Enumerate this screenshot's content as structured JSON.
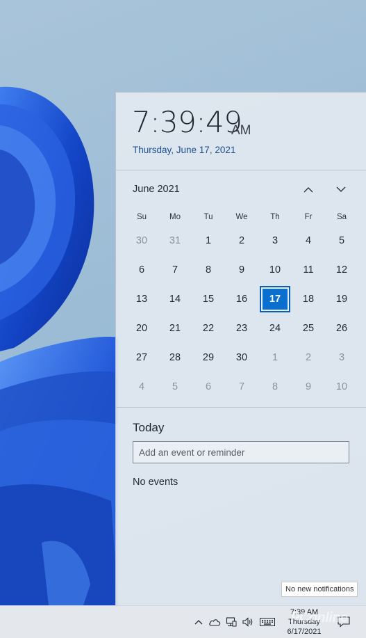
{
  "clock": {
    "time": "7:39:49",
    "ampm": "AM",
    "date": "Thursday, June 17, 2021"
  },
  "calendar": {
    "month_label": "June 2021",
    "weekdays": [
      "Su",
      "Mo",
      "Tu",
      "We",
      "Th",
      "Fr",
      "Sa"
    ],
    "weeks": [
      [
        {
          "d": "30",
          "muted": true
        },
        {
          "d": "31",
          "muted": true
        },
        {
          "d": "1"
        },
        {
          "d": "2"
        },
        {
          "d": "3"
        },
        {
          "d": "4"
        },
        {
          "d": "5"
        }
      ],
      [
        {
          "d": "6"
        },
        {
          "d": "7"
        },
        {
          "d": "8"
        },
        {
          "d": "9"
        },
        {
          "d": "10"
        },
        {
          "d": "11"
        },
        {
          "d": "12"
        }
      ],
      [
        {
          "d": "13"
        },
        {
          "d": "14"
        },
        {
          "d": "15"
        },
        {
          "d": "16"
        },
        {
          "d": "17",
          "today": true
        },
        {
          "d": "18"
        },
        {
          "d": "19"
        }
      ],
      [
        {
          "d": "20"
        },
        {
          "d": "21"
        },
        {
          "d": "22"
        },
        {
          "d": "23"
        },
        {
          "d": "24"
        },
        {
          "d": "25"
        },
        {
          "d": "26"
        }
      ],
      [
        {
          "d": "27"
        },
        {
          "d": "28"
        },
        {
          "d": "29"
        },
        {
          "d": "30"
        },
        {
          "d": "1",
          "muted": true
        },
        {
          "d": "2",
          "muted": true
        },
        {
          "d": "3",
          "muted": true
        }
      ],
      [
        {
          "d": "4",
          "muted": true
        },
        {
          "d": "5",
          "muted": true
        },
        {
          "d": "6",
          "muted": true
        },
        {
          "d": "7",
          "muted": true
        },
        {
          "d": "8",
          "muted": true
        },
        {
          "d": "9",
          "muted": true
        },
        {
          "d": "10",
          "muted": true
        }
      ]
    ],
    "nav_up_icon": "chevron-up-icon",
    "nav_down_icon": "chevron-down-icon"
  },
  "agenda": {
    "today_label": "Today",
    "input_placeholder": "Add an event or reminder",
    "input_value": "",
    "no_events": "No events"
  },
  "tooltip": {
    "text": "No new notifications"
  },
  "taskbar": {
    "tray_icons": [
      "chevron-up-icon",
      "onedrive-cloud-icon",
      "network-icon",
      "volume-icon",
      "keyboard-icon"
    ],
    "clock_time": "7:39 AM",
    "clock_day": "Thursday",
    "clock_date": "6/17/2021",
    "notification_icon": "notification-icon"
  },
  "watermark": {
    "text": "PConline"
  },
  "colors": {
    "accent": "#0b6fd0",
    "date_link": "#1c4f8c",
    "flyout_bg": "#e2e8f0",
    "wallpaper_blue": "#1e50c8"
  }
}
